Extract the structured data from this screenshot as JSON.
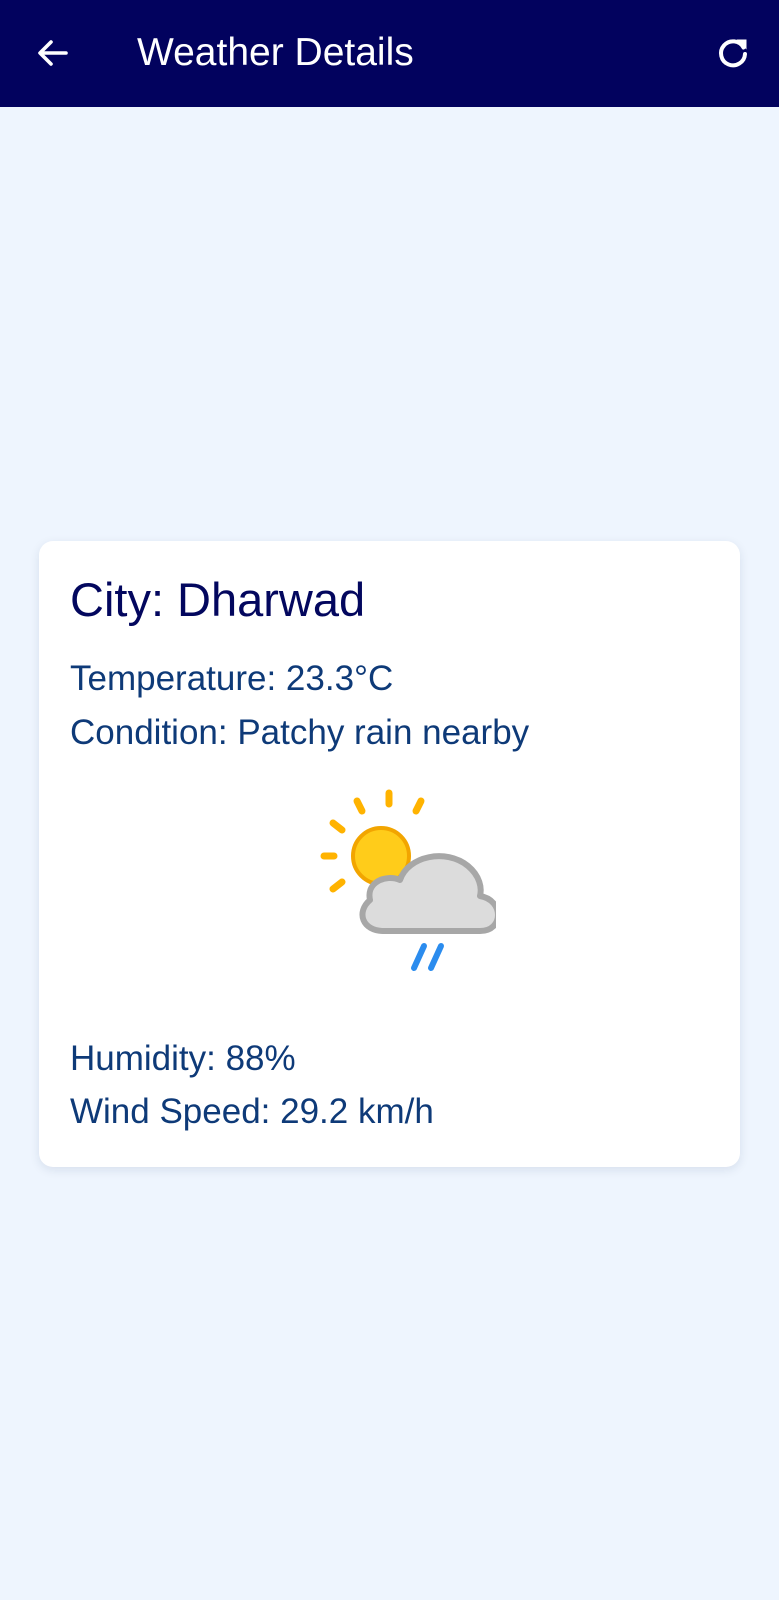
{
  "app_bar": {
    "title": "Weather Details",
    "back_icon": "arrow-left-icon",
    "refresh_icon": "refresh-icon",
    "background_color": "#02025e"
  },
  "weather": {
    "city_text": "City: Dharwad",
    "temperature_text": "Temperature: 23.3°C",
    "condition_text": "Condition: Patchy rain nearby",
    "condition_icon": "patchy-rain-icon",
    "humidity_text": "Humidity: 88%",
    "wind_speed_text": "Wind Speed: 29.2 km/h"
  },
  "colors": {
    "page_background": "#eef5fe",
    "card_background": "#ffffff",
    "title_text": "#03075e",
    "body_text": "#0e3a78"
  }
}
